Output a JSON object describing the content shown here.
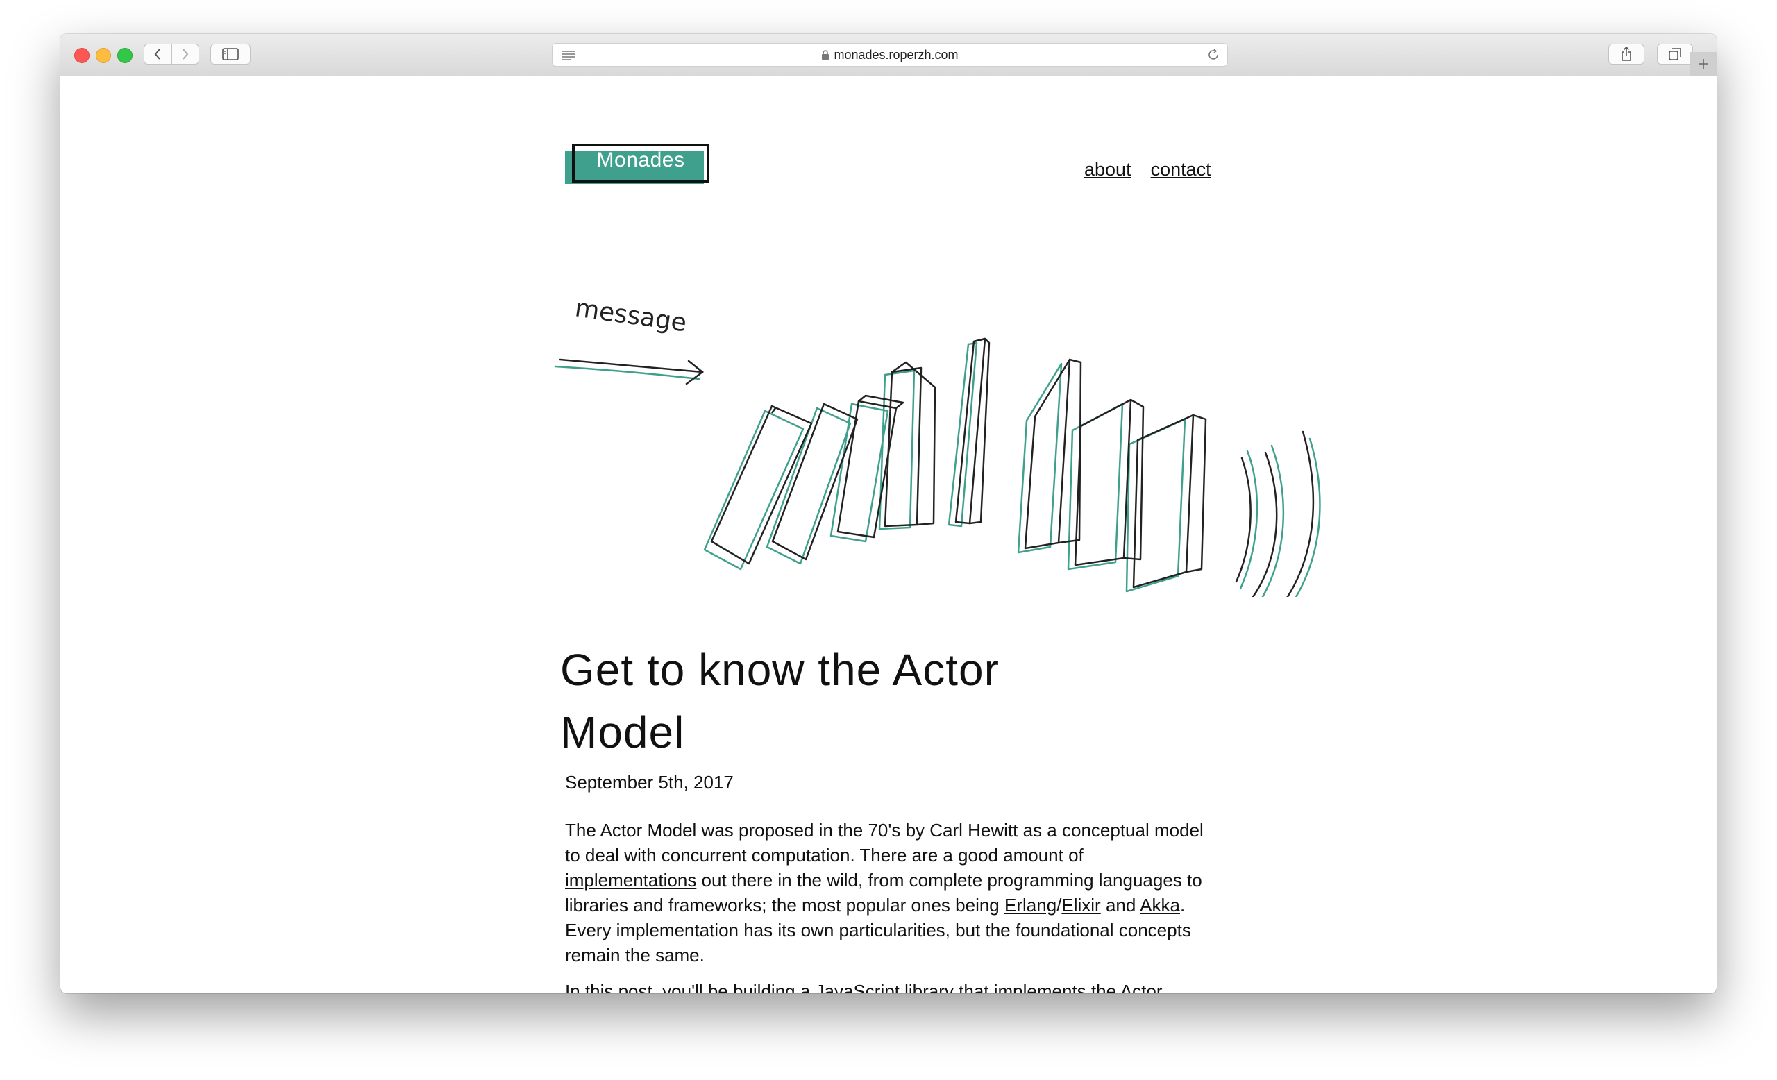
{
  "browser": {
    "url": "monades.roperzh.com"
  },
  "site": {
    "logo": "Monades",
    "nav": [
      "about",
      "contact"
    ]
  },
  "hero": {
    "label": "message",
    "accent_color": "#3fa08d"
  },
  "post": {
    "title_line1": "Get to know the Actor",
    "title_line2": "Model",
    "date": "September 5th, 2017",
    "p1": {
      "t1": "The Actor Model was proposed in the 70's by Carl Hewitt as a conceptual model to deal with concurrent computation. There are a good amount of ",
      "link1": "implementations",
      "t2": " out there in the wild, from complete programming languages to libraries and frameworks; the most popular ones being ",
      "link2": "Erlang",
      "sep": "/",
      "link3": "Elixir",
      "t3": " and ",
      "link4": "Akka",
      "t4": ". Every implementation has its own particularities, but the foundational concepts remain the same."
    },
    "p2": "In this post, you'll be building a JavaScript library that implements the Actor"
  }
}
